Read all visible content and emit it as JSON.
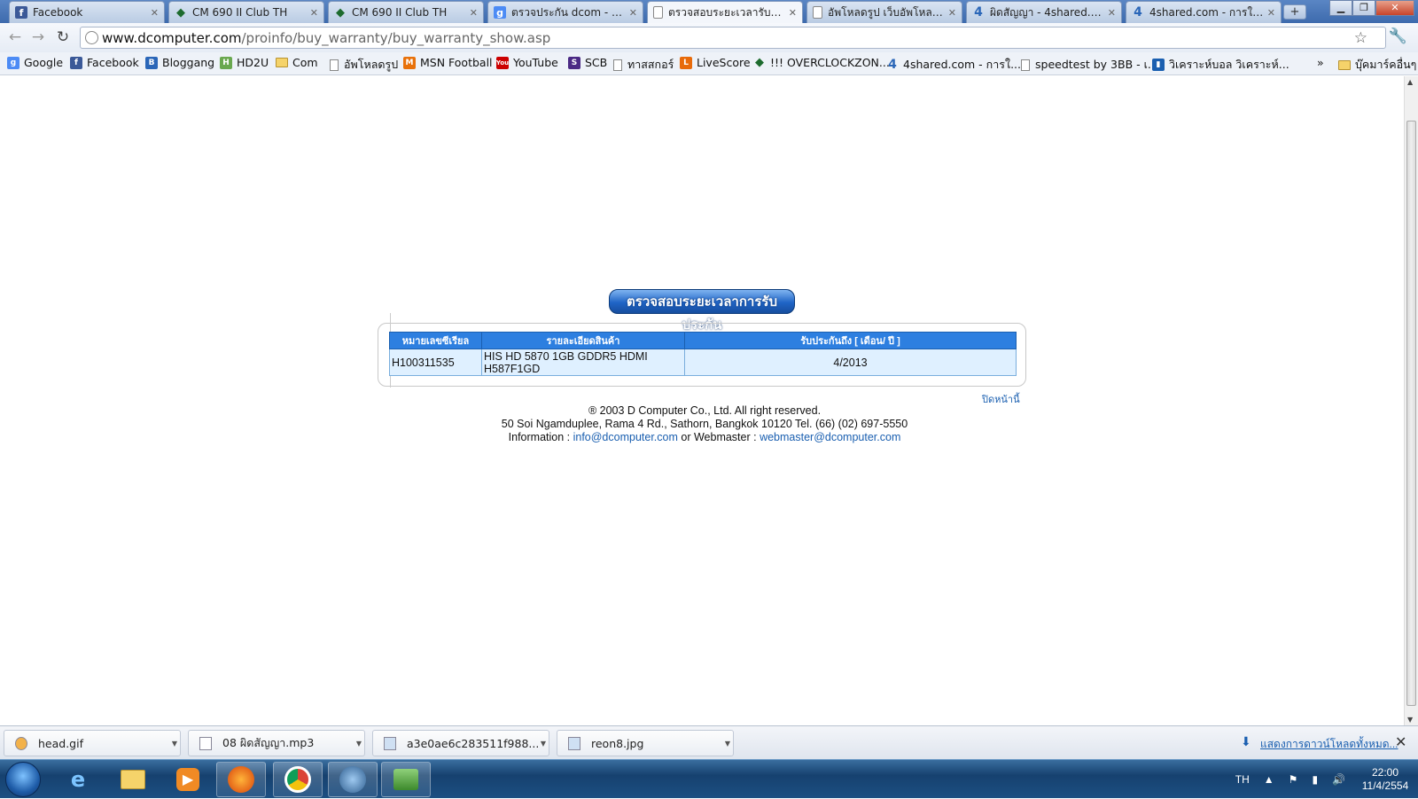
{
  "tabs": [
    {
      "title": "Facebook",
      "icon": "facebook-icon",
      "active": false
    },
    {
      "title": "CM 690 II Club TH",
      "icon": "diamond-icon",
      "active": false
    },
    {
      "title": "CM 690 II Club TH",
      "icon": "diamond-icon",
      "active": false
    },
    {
      "title": "ตรวจประกัน dcom - ค้น...",
      "icon": "google-icon",
      "active": false
    },
    {
      "title": "ตรวจสอบระยะเวลารับประ...",
      "icon": "page-icon",
      "active": true
    },
    {
      "title": "อัพโหลดรูป เว็บอัพโหลดรู...",
      "icon": "page-icon",
      "active": false
    },
    {
      "title": "ผิดสัญญา - 4shared.co...",
      "icon": "4shared-icon",
      "active": false
    },
    {
      "title": "4shared.com - การใช้แ...",
      "icon": "4shared-icon",
      "active": false
    }
  ],
  "address": {
    "host": "www.dcomputer.com",
    "path": "/proinfo/buy_warranty/buy_warranty_show.asp"
  },
  "bookmarks": [
    {
      "label": "Google",
      "icon": "google-icon"
    },
    {
      "label": "Facebook",
      "icon": "facebook-icon"
    },
    {
      "label": "Bloggang",
      "icon": "bloggang-icon"
    },
    {
      "label": "HD2U",
      "icon": "hd2u-icon"
    },
    {
      "label": "Com",
      "icon": "folder-icon"
    },
    {
      "label": "อัพโหลดรูป",
      "icon": "page-icon"
    },
    {
      "label": "MSN Football",
      "icon": "msn-icon"
    },
    {
      "label": "YouTube",
      "icon": "youtube-icon"
    },
    {
      "label": "SCB",
      "icon": "scb-icon"
    },
    {
      "label": "ทาสสกอร์",
      "icon": "page-icon"
    },
    {
      "label": "LiveScore",
      "icon": "livescore-icon"
    },
    {
      "label": "!!! OVERCLOCKZON...",
      "icon": "diamond-icon"
    },
    {
      "label": "4shared.com - การใ...",
      "icon": "4shared-icon"
    },
    {
      "label": "speedtest by 3BB - เ...",
      "icon": "page-icon"
    },
    {
      "label": "วิเคราะห์บอล วิเคราะห์...",
      "icon": "page-icon"
    }
  ],
  "bookmarks_more": "»",
  "other_bookmarks": "บุ๊คมาร์คอื่นๆ",
  "page": {
    "button_label": "ตรวจสอบระยะเวลาการรับประกัน",
    "table": {
      "headers": [
        "หมายเลขซีเรียล",
        "รายละเอียดสินค้า",
        "รับประกันถึง [ เดือน/ ปี ]"
      ],
      "rows": [
        {
          "serial": "H100311535",
          "detail_line1": "HIS HD 5870 1GB GDDR5 HDMI",
          "detail_line2": "H587F1GD",
          "warranty": "4/2013"
        }
      ]
    },
    "close_label": "ปิดหน้านี้",
    "footer": {
      "copyright": "® 2003 D Computer Co., Ltd. All right reserved.",
      "address": "50 Soi Ngamduplee, Rama 4 Rd., Sathorn, Bangkok 10120 Tel. (66) (02) 697-5550",
      "info_label": "Information : ",
      "info_email": "info@dcomputer.com",
      "or_webmaster": " or Webmaster : ",
      "webmaster_email": "webmaster@dcomputer.com"
    }
  },
  "downloads": [
    {
      "name": "head.gif"
    },
    {
      "name": "08 ผิดสัญญา.mp3"
    },
    {
      "name": "a3e0ae6c283511f988....jpg"
    },
    {
      "name": "reon8.jpg"
    }
  ],
  "show_all_downloads": "แสดงการดาวน์โหลดทั้งหมด...",
  "tray": {
    "lang": "TH",
    "time": "22:00",
    "date": "11/4/2554"
  },
  "colors": {
    "header_blue": "#2d7fe0",
    "cell_bg": "#dff0ff",
    "link": "#1a5fb0"
  }
}
